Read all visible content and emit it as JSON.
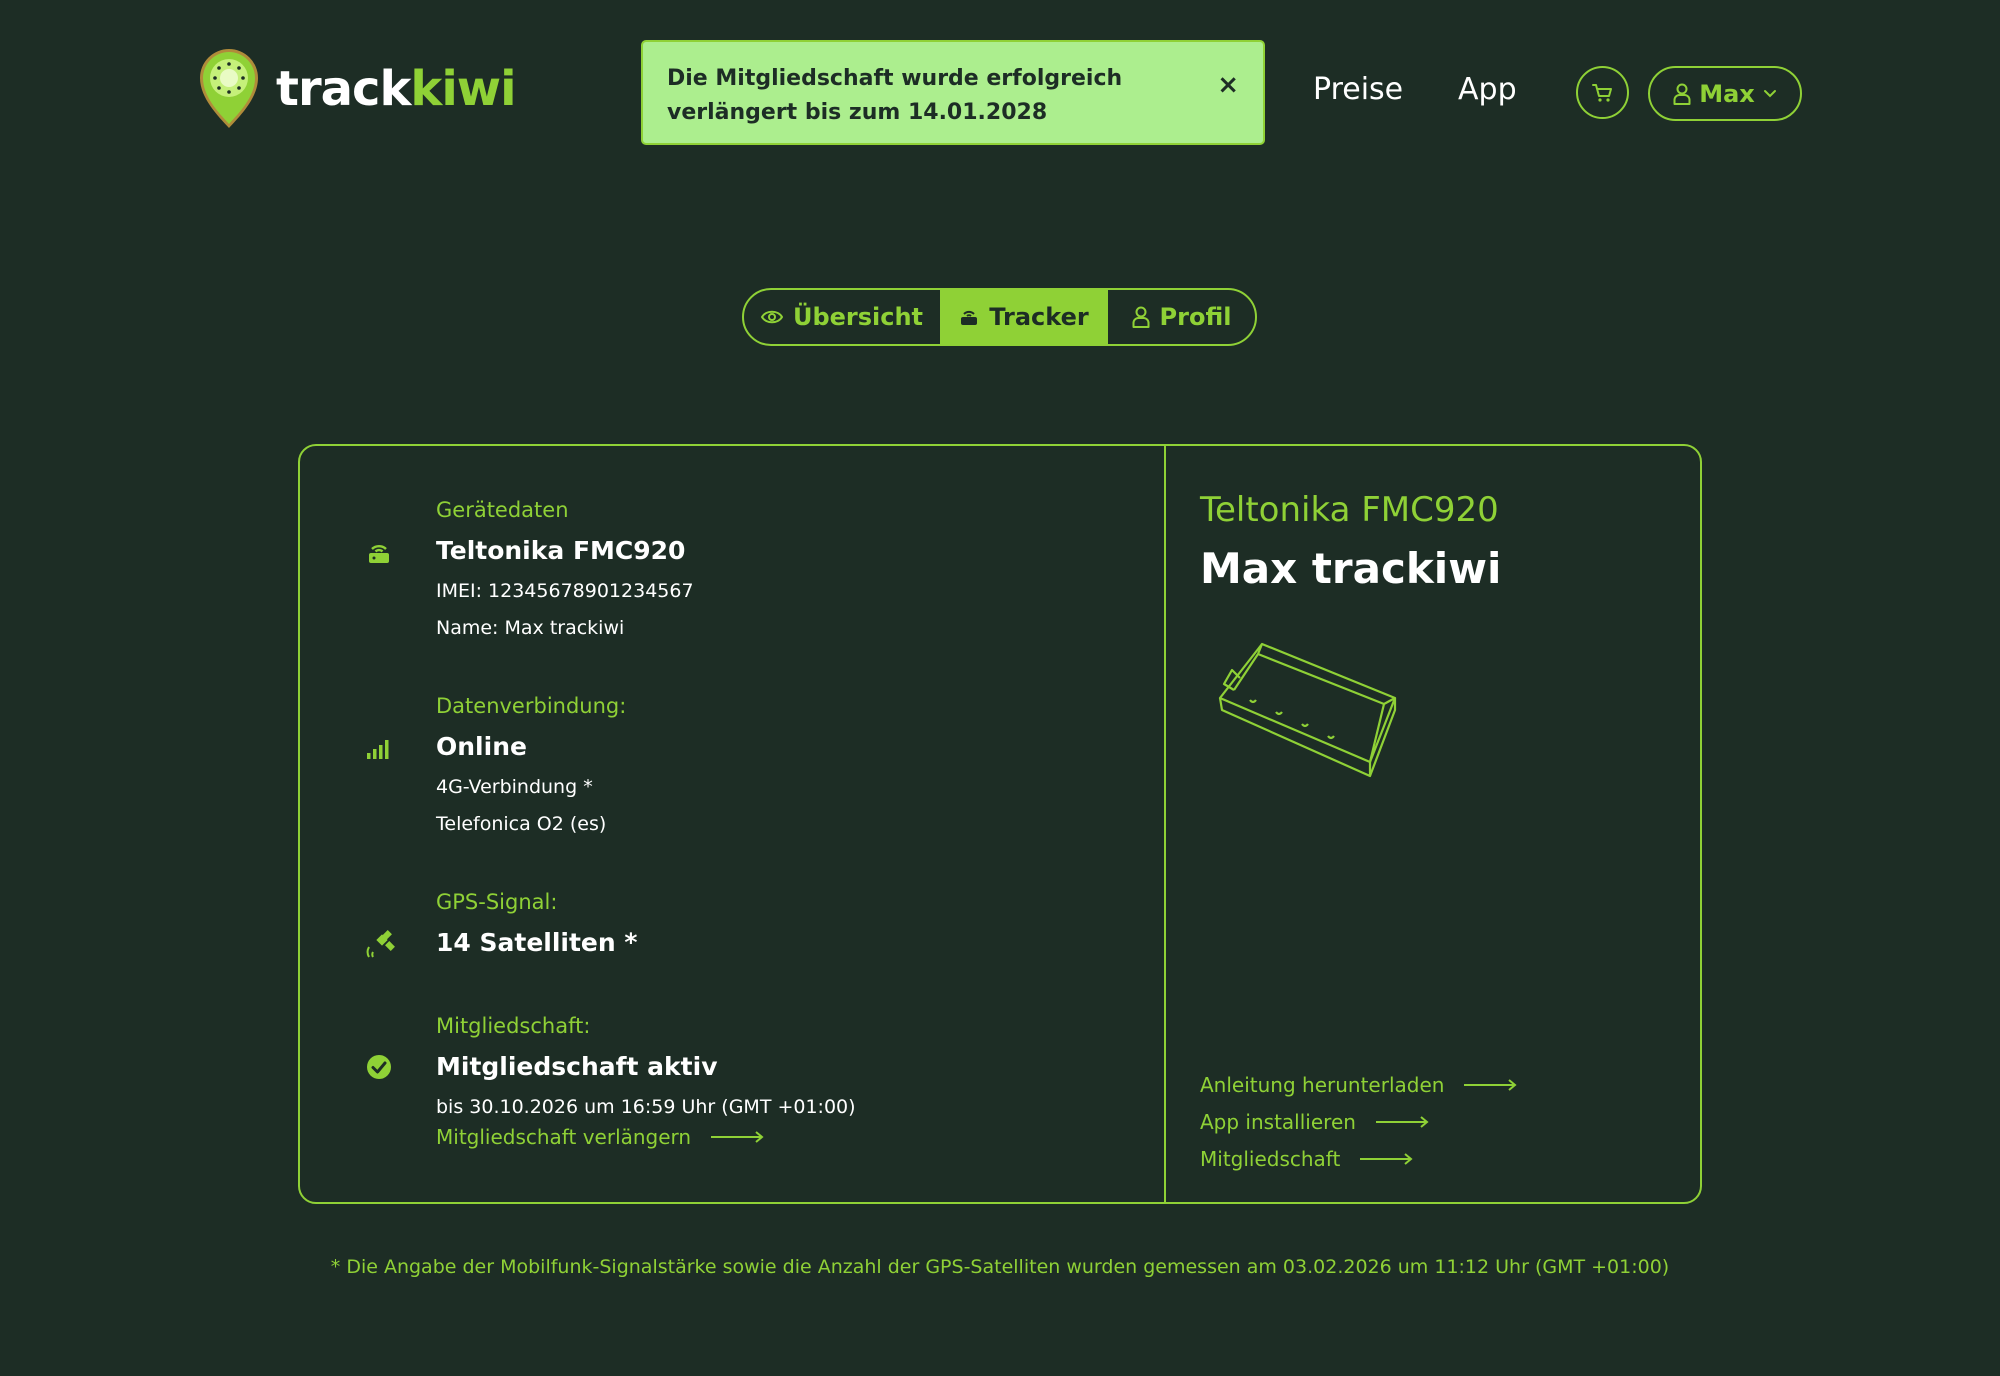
{
  "brand": {
    "logo_part1": "track",
    "logo_part2": "kiwi",
    "accent_color": "#8fd136",
    "background_color": "#1d2d25"
  },
  "toast": {
    "message": "Die Mitgliedschaft wurde erfolgreich verlängert bis zum 14.01.2028",
    "close_label": "×"
  },
  "nav": {
    "preise": "Preise",
    "app": "App",
    "cart_icon": "cart-icon",
    "user_label": "Max"
  },
  "tabs": [
    {
      "label": "Übersicht",
      "icon": "eye-icon",
      "active": false
    },
    {
      "label": "Tracker",
      "icon": "router-icon",
      "active": true
    },
    {
      "label": "Profil",
      "icon": "user-icon",
      "active": false
    }
  ],
  "device": {
    "label": "Gerätedaten",
    "model": "Teltonika FMC920",
    "imei": "IMEI: 12345678901234567",
    "name": "Name: Max trackiwi"
  },
  "connection": {
    "label": "Datenverbindung:",
    "status": "Online",
    "type": "4G-Verbindung *",
    "carrier": "Telefonica O2 (es)"
  },
  "gps": {
    "label": "GPS-Signal:",
    "satellites": "14 Satelliten *"
  },
  "membership": {
    "label": "Mitgliedschaft:",
    "status": "Mitgliedschaft aktiv",
    "until": "bis 30.10.2026 um 16:59 Uhr (GMT +01:00)",
    "extend_link": "Mitgliedschaft verlängern"
  },
  "right_panel": {
    "model": "Teltonika FMC920",
    "name": "Max trackiwi",
    "links": [
      "Anleitung herunterladen",
      "App installieren",
      "Mitgliedschaft"
    ]
  },
  "footnote": "* Die Angabe der Mobilfunk-Signalstärke sowie die Anzahl der GPS-Satelliten wurden gemessen am 03.02.2026 um 11:12 Uhr (GMT +01:00)"
}
